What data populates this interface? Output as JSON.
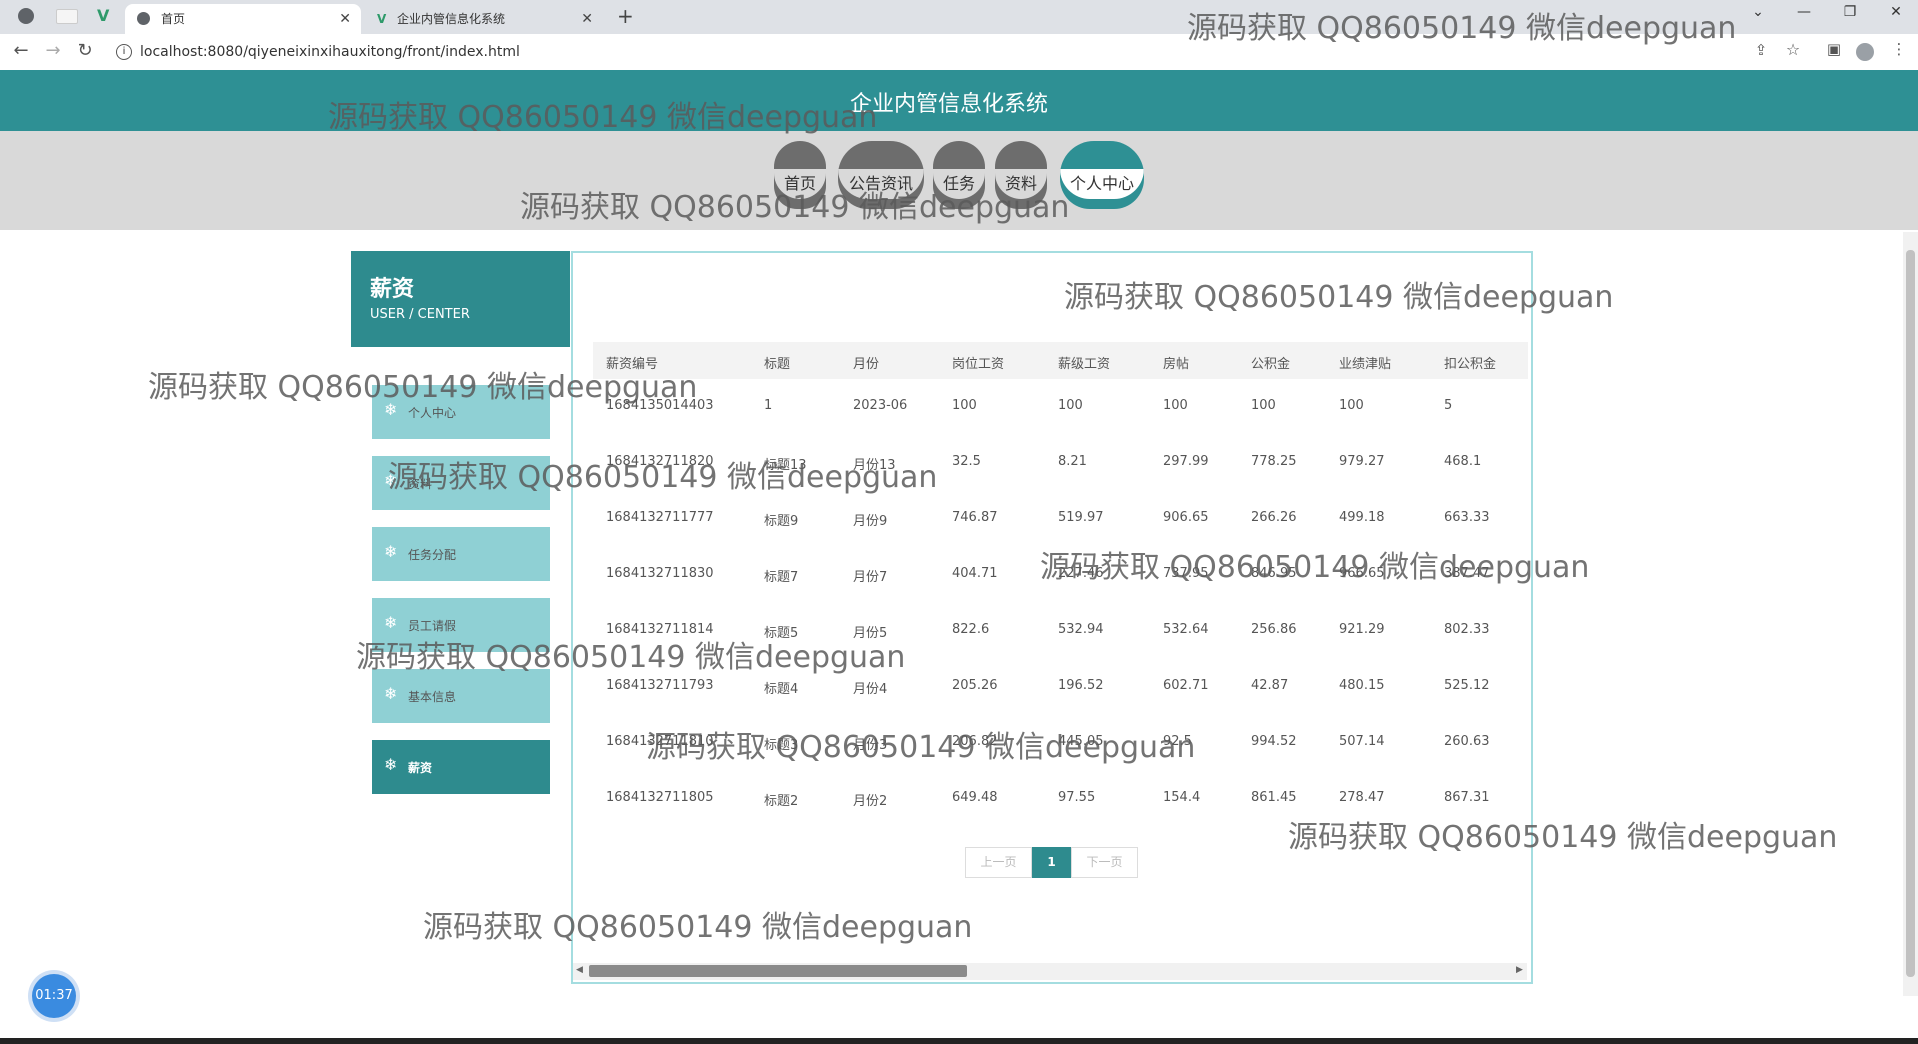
{
  "browser": {
    "tabs": [
      {
        "label": "首页",
        "active": true
      },
      {
        "label": "企业内管信息化系统",
        "active": false
      }
    ],
    "url": "localhost:8080/qiyeneixinxihauxitong/front/index.html"
  },
  "site": {
    "title": "企业内管信息化系统",
    "nav": [
      {
        "label": "首页",
        "active": false
      },
      {
        "label": "公告资讯",
        "active": false
      },
      {
        "label": "任务",
        "active": false
      },
      {
        "label": "资料",
        "active": false
      },
      {
        "label": "个人中心",
        "active": true
      }
    ]
  },
  "sidebar": {
    "title": "薪资",
    "subtitle": "USER / CENTER",
    "items": [
      {
        "label": "个人中心",
        "active": false
      },
      {
        "label": "资料",
        "active": false
      },
      {
        "label": "任务分配",
        "active": false
      },
      {
        "label": "员工请假",
        "active": false
      },
      {
        "label": "基本信息",
        "active": false
      },
      {
        "label": "薪资",
        "active": true
      }
    ]
  },
  "table": {
    "columns": [
      "薪资编号",
      "标题",
      "月份",
      "岗位工资",
      "薪级工资",
      "房帖",
      "公积金",
      "业绩津贴",
      "扣公积金"
    ],
    "rows": [
      [
        "1684135014403",
        "1",
        "2023-06",
        "100",
        "100",
        "100",
        "100",
        "100",
        "5"
      ],
      [
        "1684132711820",
        "标题13",
        "月份13",
        "32.5",
        "8.21",
        "297.99",
        "778.25",
        "979.27",
        "468.1"
      ],
      [
        "1684132711777",
        "标题9",
        "月份9",
        "746.87",
        "519.97",
        "906.65",
        "266.26",
        "499.18",
        "663.33"
      ],
      [
        "1684132711830",
        "标题7",
        "月份7",
        "404.71",
        "227.46",
        "737.95",
        "846.95",
        "966.65",
        "387.47"
      ],
      [
        "1684132711814",
        "标题5",
        "月份5",
        "822.6",
        "532.94",
        "532.64",
        "256.86",
        "921.29",
        "802.33"
      ],
      [
        "1684132711793",
        "标题4",
        "月份4",
        "205.26",
        "196.52",
        "602.71",
        "42.87",
        "480.15",
        "525.12"
      ],
      [
        "1684132711810",
        "标题3",
        "月份3",
        "206.82",
        "445.05",
        "92.5",
        "994.52",
        "507.14",
        "260.63"
      ],
      [
        "1684132711805",
        "标题2",
        "月份2",
        "649.48",
        "97.55",
        "154.4",
        "861.45",
        "278.47",
        "867.31"
      ]
    ]
  },
  "pager": {
    "prev": "上一页",
    "current": "1",
    "next": "下一页"
  },
  "timer": "01:37",
  "watermark": "源码获取 QQ86050149 微信deepguan",
  "colors": {
    "primary": "#2e9094",
    "menu_item": "#8fd0d4",
    "nav_band": "#d9d9d9"
  }
}
